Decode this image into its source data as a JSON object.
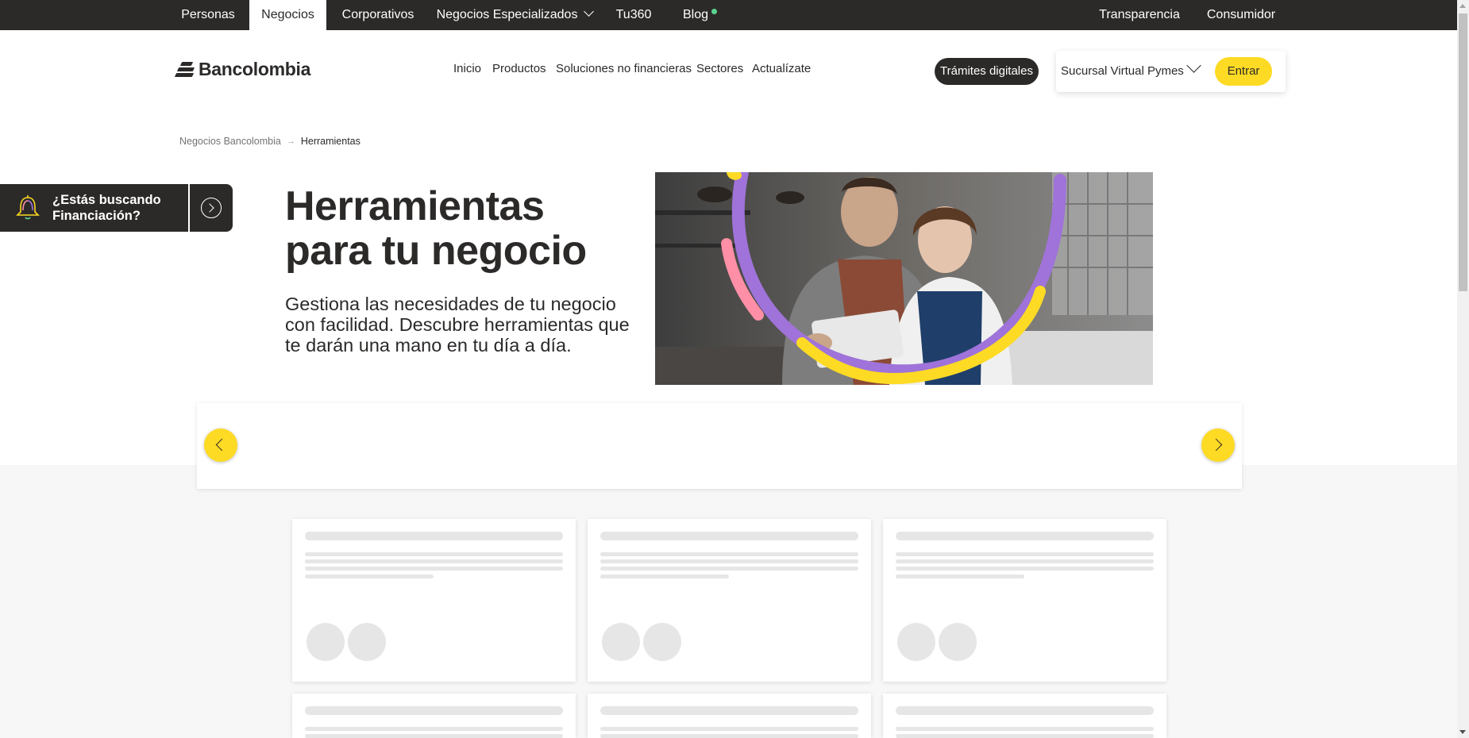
{
  "topbar": {
    "tabs": [
      {
        "label": "Personas"
      },
      {
        "label": "Negocios"
      },
      {
        "label": "Corporativos"
      },
      {
        "label": "Negocios Especializados"
      },
      {
        "label": "Tu360"
      },
      {
        "label": "Blog"
      }
    ],
    "right_links": [
      {
        "label": "Transparencia"
      },
      {
        "label": "Consumidor"
      }
    ],
    "active_tab": "Negocios"
  },
  "header": {
    "logo_text": "Bancolombia",
    "nav": [
      {
        "label": "Inicio"
      },
      {
        "label": "Productos"
      },
      {
        "label": "Soluciones no financieras"
      },
      {
        "label": "Sectores"
      },
      {
        "label": "Actualízate"
      }
    ],
    "tramites_label": "Trámites digitales",
    "sucursal_label": "Sucursal Virtual Pymes",
    "entrar_label": "Entrar"
  },
  "breadcrumb": {
    "items": [
      {
        "label": "Negocios Bancolombia"
      },
      {
        "label": "Herramientas"
      }
    ]
  },
  "financing": {
    "label": "¿Estás buscando Financiación?"
  },
  "hero": {
    "title": "Herramientas para tu negocio",
    "subtitle": "Gestiona las necesidades de tu negocio con facilidad. Descubre herramientas que te darán una mano en tu día a día."
  },
  "colors": {
    "dark": "#2c2a29",
    "yellow": "#fdda24",
    "purple": "#9f73d9",
    "pink": "#ff8fa6",
    "green_dot": "#59d48f",
    "page_bg": "#f7f7f7",
    "skeleton": "#e6e6e6"
  },
  "icons": {
    "financing": "bell-icon",
    "financing_go": "arrow-circle-right-icon",
    "carousel_prev": "chevron-left-icon",
    "carousel_next": "chevron-right-icon",
    "dropdown": "chevron-down-icon"
  }
}
